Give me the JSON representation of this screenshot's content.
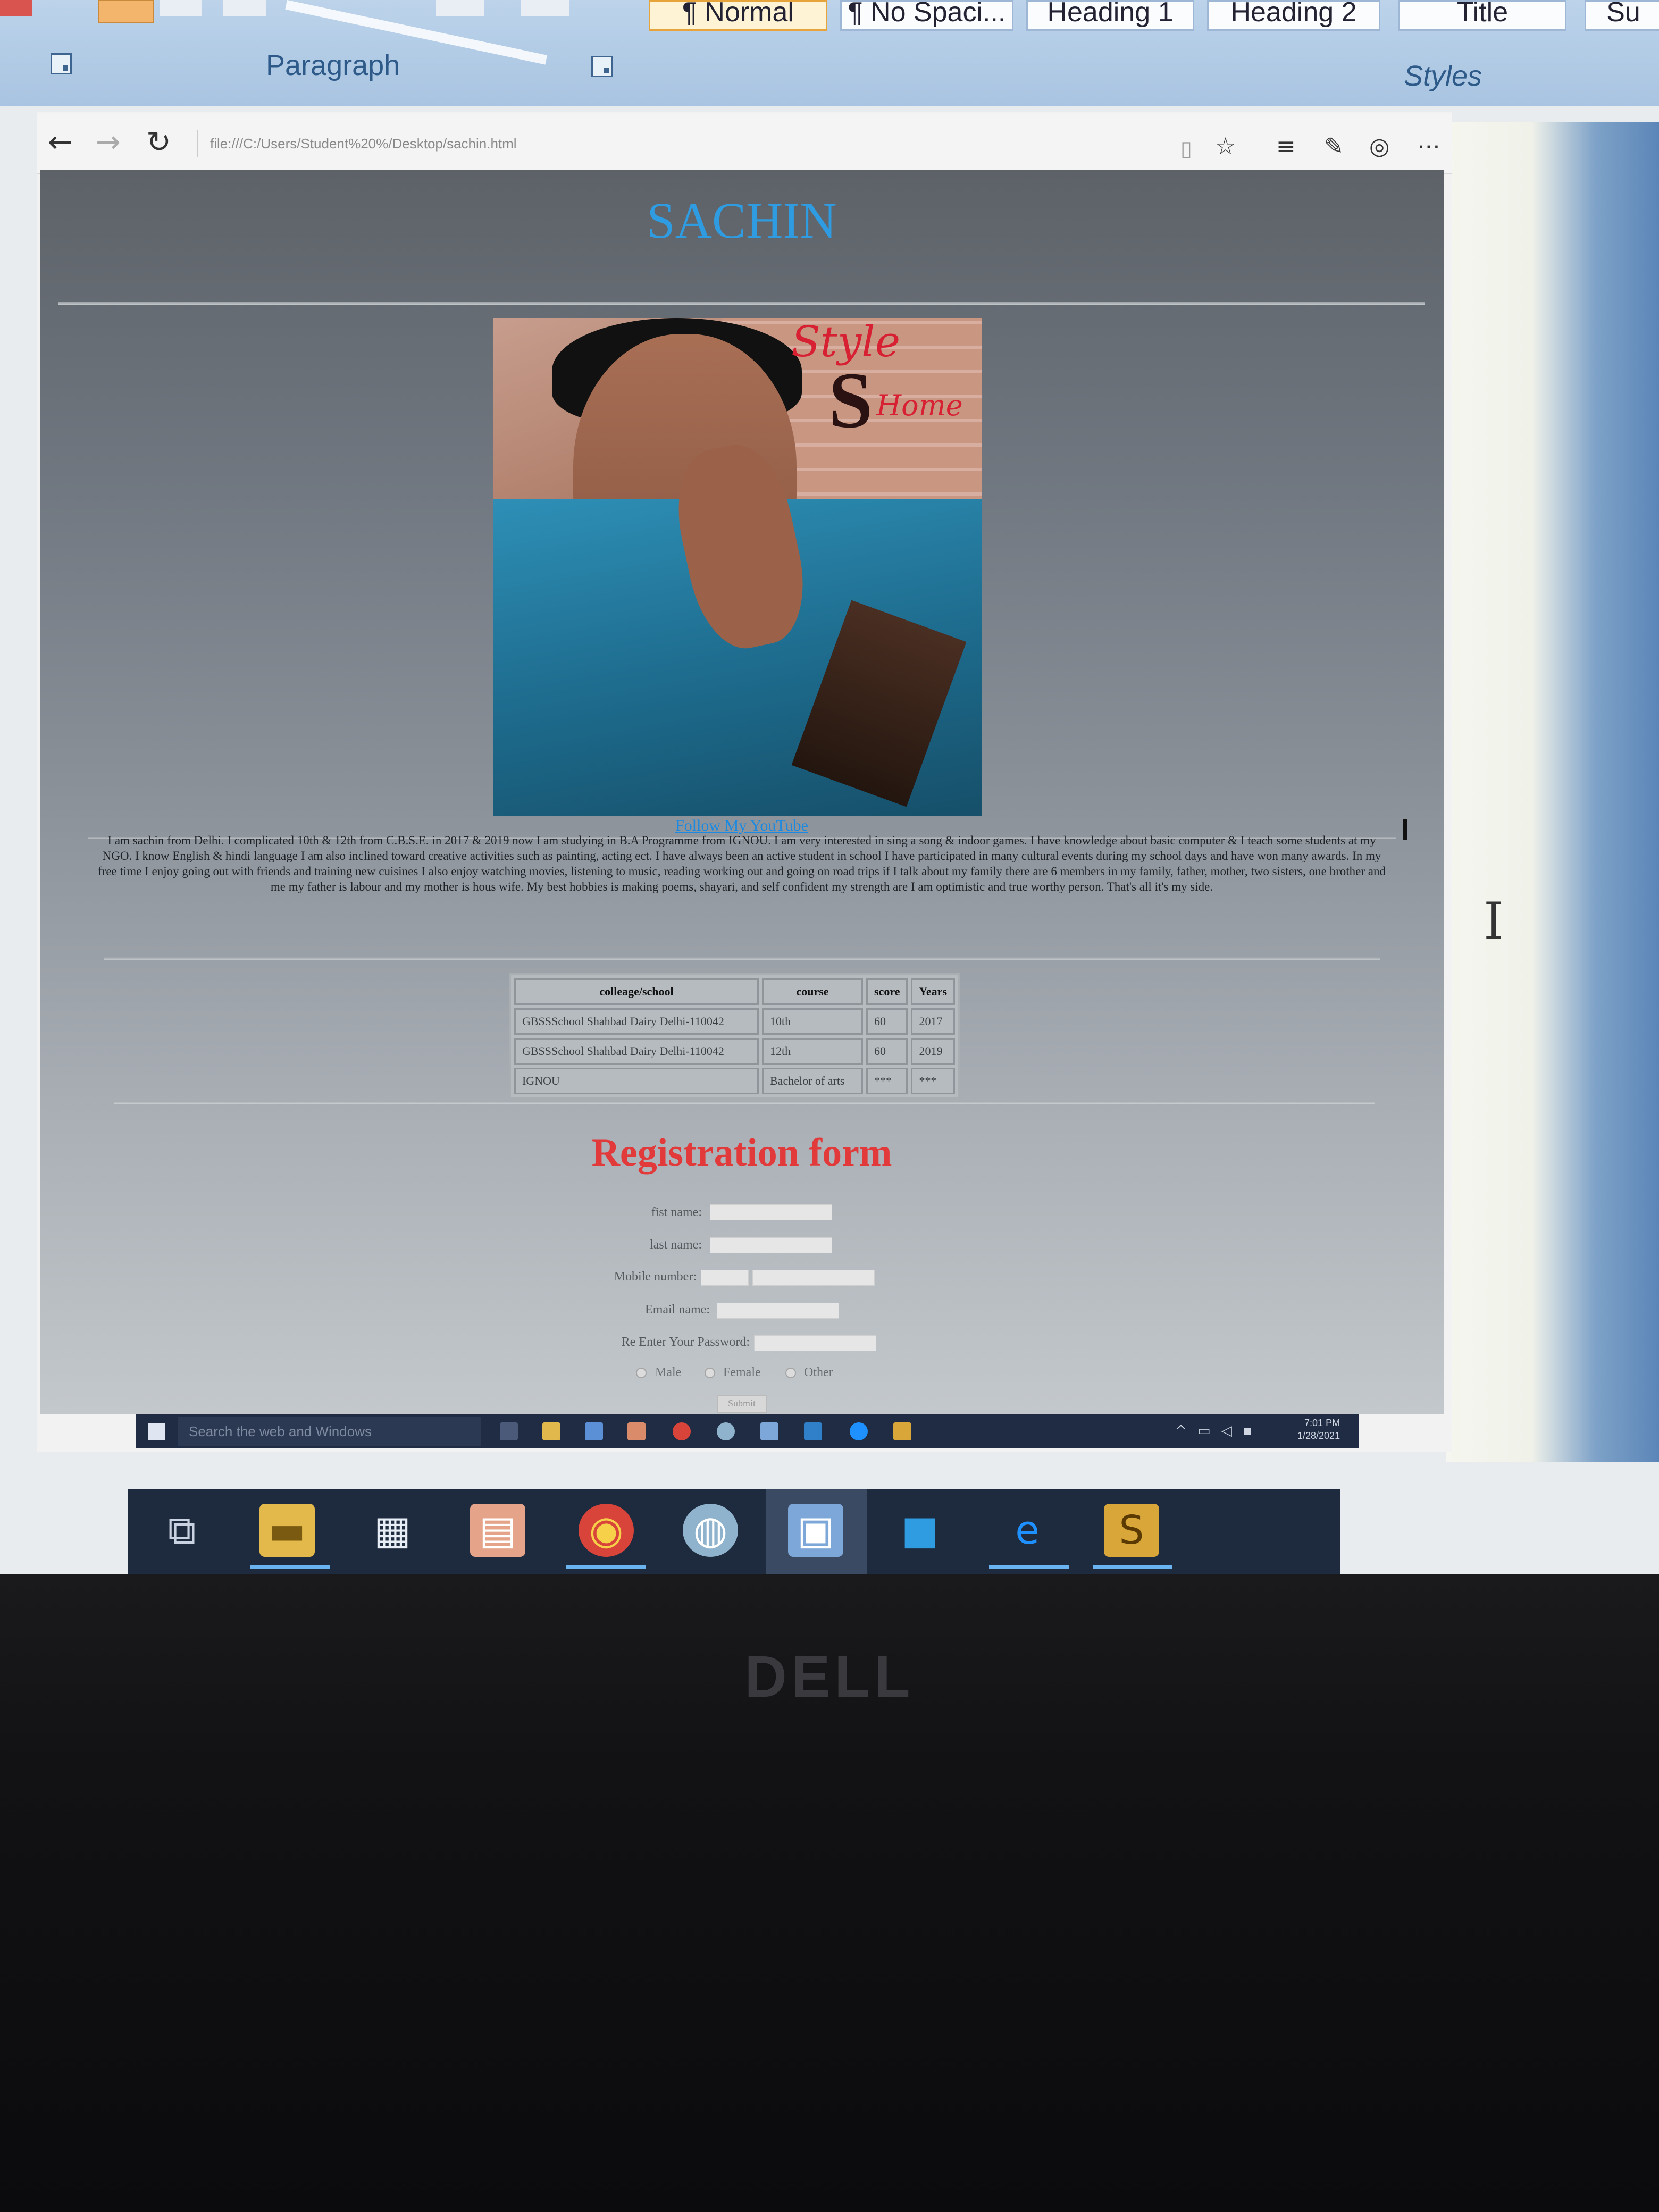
{
  "ribbon": {
    "styles": [
      "¶ Normal",
      "¶ No Spaci...",
      "Heading 1",
      "Heading 2",
      "Title",
      "Su"
    ],
    "paragraph_group_label": "Paragraph",
    "styles_group_label": "Styles"
  },
  "browser": {
    "url": "file:///C:/Users/Student%20%/Desktop/sachin.html"
  },
  "page": {
    "title": "SACHIN",
    "logo_script": "Style",
    "logo_letter": "S",
    "logo_sub": "Home",
    "youtube_link": "Follow My YouTube",
    "about": "I am sachin from Delhi. I complicated 10th & 12th from C.B.S.E. in 2017 & 2019 now I am studying in B.A Programme from IGNOU. I am very interested in sing a song & indoor games. I have knowledge about basic computer & I teach some students at my NGO. I know English & hindi language I am also inclined toward creative activities such as painting, acting ect. I have always been an active student in school I have participated in many cultural events during my school days and have won many awards. In my free time I enjoy going out with friends and training new cuisines I also enjoy watching movies, listening to music, reading working out and going on road trips if I talk about my family there are 6 members in my family, father, mother, two sisters, one brother and me my father is labour and my mother is hous wife. My best hobbies is making poems, shayari, and self confident my strength are I am optimistic and true worthy person. That's all it's my side.",
    "table": {
      "headers": [
        "colleage/school",
        "course",
        "score",
        "Years"
      ],
      "rows": [
        [
          "GBSSSchool Shahbad Dairy Delhi-110042",
          "10th",
          "60",
          "2017"
        ],
        [
          "GBSSSchool Shahbad Dairy Delhi-110042",
          "12th",
          "60",
          "2019"
        ],
        [
          "IGNOU",
          "Bachelor of arts",
          "***",
          "***"
        ]
      ]
    },
    "registration": {
      "title": "Registration form",
      "first_name_label": "fist name:",
      "last_name_label": "last name:",
      "mobile_label": "Mobile number:",
      "email_label": "Email name:",
      "reenter_password_label": "Re Enter Your Password:",
      "gender_options": [
        "Male",
        "Female",
        "Other"
      ],
      "submit_label": "Submit"
    }
  },
  "inner_taskbar": {
    "search_placeholder": "Search the web and Windows",
    "time": "7:01 PM",
    "date": "1/28/2021"
  },
  "laptop": {
    "brand": "DELL"
  },
  "colors": {
    "title_blue": "#2f9be0",
    "registration_red": "#e23a3a",
    "link_blue": "#1c8ae0"
  }
}
